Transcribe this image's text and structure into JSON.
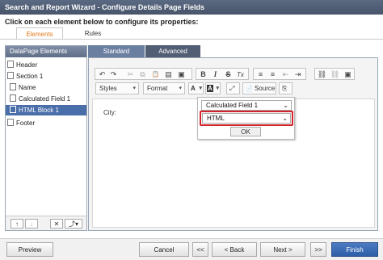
{
  "window": {
    "title": "Search and Report Wizard - Configure Details Page Fields"
  },
  "instruction": "Click on each element below to configure its properties:",
  "main_tabs": [
    {
      "label": "Elements"
    },
    {
      "label": "Rules"
    }
  ],
  "left_panel": {
    "header": "DataPage Elements",
    "items": [
      {
        "label": "Header"
      },
      {
        "label": "Section 1"
      },
      {
        "label": "Name"
      },
      {
        "label": "Calculated Field 1"
      },
      {
        "label": "HTML Block 1"
      },
      {
        "label": "Footer"
      }
    ],
    "toolbar": {
      "up": "↑",
      "down": "↓",
      "delete": "✕",
      "insert": "⤴▾"
    }
  },
  "editor_tabs": [
    {
      "label": "Standard"
    },
    {
      "label": "Advanced"
    }
  ],
  "editor": {
    "styles_label": "Styles",
    "format_label": "Format",
    "source_label": "Source",
    "content_text": "City:",
    "icons": {
      "undo": "↶",
      "redo": "↷",
      "cut": "✂",
      "copy": "⧉",
      "paste": "📋",
      "paste_text": "▤",
      "paste_word": "▣",
      "bold": "B",
      "italic": "I",
      "strike": "S",
      "remove_format": "Tx",
      "numbered_list": "≡",
      "bulleted_list": "≡",
      "outdent": "⇤",
      "indent": "⇥",
      "link": "⛓",
      "unlink": "⛓",
      "image": "▣",
      "font_color": "A",
      "bg_color": "A",
      "maximize": "⤢",
      "source": "📄",
      "templates": "⎘"
    }
  },
  "insert_popup": {
    "field_select": "Calculated Field 1",
    "format_select": "HTML",
    "ok_label": "OK"
  },
  "footer_buttons": {
    "preview": "Preview",
    "cancel": "Cancel",
    "first": "<<",
    "back": "< Back",
    "next": "Next >",
    "last": ">>",
    "finish": "Finish"
  },
  "colors": {
    "accent": "#e37a1f",
    "selected": "#4a6ea9",
    "highlight": "#d2232a",
    "finish": "#2e5ea8"
  }
}
